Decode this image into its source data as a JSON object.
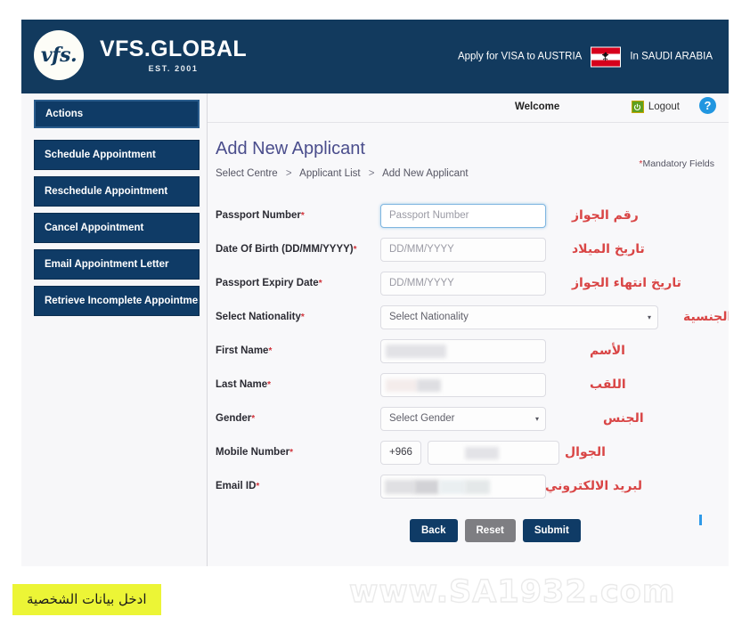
{
  "header": {
    "logo_mark": "vfs.",
    "logo_name": "VFS.GLOBAL",
    "logo_est": "EST. 2001",
    "apply_prefix": "Apply for VISA to AUSTRIA",
    "apply_suffix": "In SAUDI ARABIA",
    "flag_country": "Austria",
    "flag_emblem": "⚫",
    "bg_color": "#123a5e"
  },
  "topbar": {
    "welcome": "Welcome",
    "logout": "Logout",
    "power_glyph": "⏻",
    "help_glyph": "?"
  },
  "sidebar": {
    "heading": "Actions",
    "items": [
      {
        "label": "Schedule Appointment"
      },
      {
        "label": "Reschedule Appointment"
      },
      {
        "label": "Cancel Appointment"
      },
      {
        "label": "Email Appointment Letter"
      },
      {
        "label": "Retrieve Incomplete Appointments"
      }
    ]
  },
  "main": {
    "title": "Add New Applicant",
    "breadcrumb": {
      "item1": "Select Centre",
      "sep1": ">",
      "item2": "Applicant List",
      "sep2": ">",
      "item3": "Add New Applicant"
    },
    "mandatory_star": "*",
    "mandatory_note": "Mandatory Fields",
    "fields": [
      {
        "label": "Passport Number",
        "required": "*",
        "type": "text",
        "placeholder": "Passport Number",
        "value": "",
        "annotation": "رقم الجواز"
      },
      {
        "label": "Date Of Birth (DD/MM/YYYY)",
        "required": "*",
        "type": "text",
        "placeholder": "DD/MM/YYYY",
        "value": "",
        "annotation": "تاريخ الميلاد"
      },
      {
        "label": "Passport Expiry Date",
        "required": "*",
        "type": "text",
        "placeholder": "DD/MM/YYYY",
        "value": "",
        "annotation": "تاريخ انتهاء الجواز"
      },
      {
        "label": "Select Nationality",
        "required": "*",
        "type": "select",
        "placeholder": "Select Nationality",
        "value": "Select Nationality",
        "annotation": "الجنسية"
      },
      {
        "label": "First Name",
        "required": "*",
        "type": "text",
        "placeholder": "",
        "value": "",
        "annotation": "الأسم"
      },
      {
        "label": "Last Name",
        "required": "*",
        "type": "text",
        "placeholder": "",
        "value": "",
        "annotation": "اللقب"
      },
      {
        "label": "Gender",
        "required": "*",
        "type": "select",
        "placeholder": "Select Gender",
        "value": "Select Gender",
        "annotation": "الجنس"
      },
      {
        "label": "Mobile Number",
        "required": "*",
        "type": "phone",
        "country_code": "+966",
        "placeholder": "",
        "value": "",
        "annotation": "الجوال"
      },
      {
        "label": "Email ID",
        "required": "*",
        "type": "text",
        "placeholder": "",
        "value": "",
        "annotation": "لبريد الالكتروني"
      }
    ],
    "buttons": {
      "back": "Back",
      "reset": "Reset",
      "submit": "Submit"
    },
    "select_caret": "▾"
  },
  "overlay": {
    "yellow_note": "ادخل بيانات الشخصية",
    "watermark": "www.SA1932.com"
  },
  "colors": {
    "brand_navy": "#123a5e",
    "title_purple": "#4a4d8c",
    "annotation_red": "#d94545",
    "highlight_yellow": "#ecf536",
    "reset_gray": "#7e7e82"
  }
}
